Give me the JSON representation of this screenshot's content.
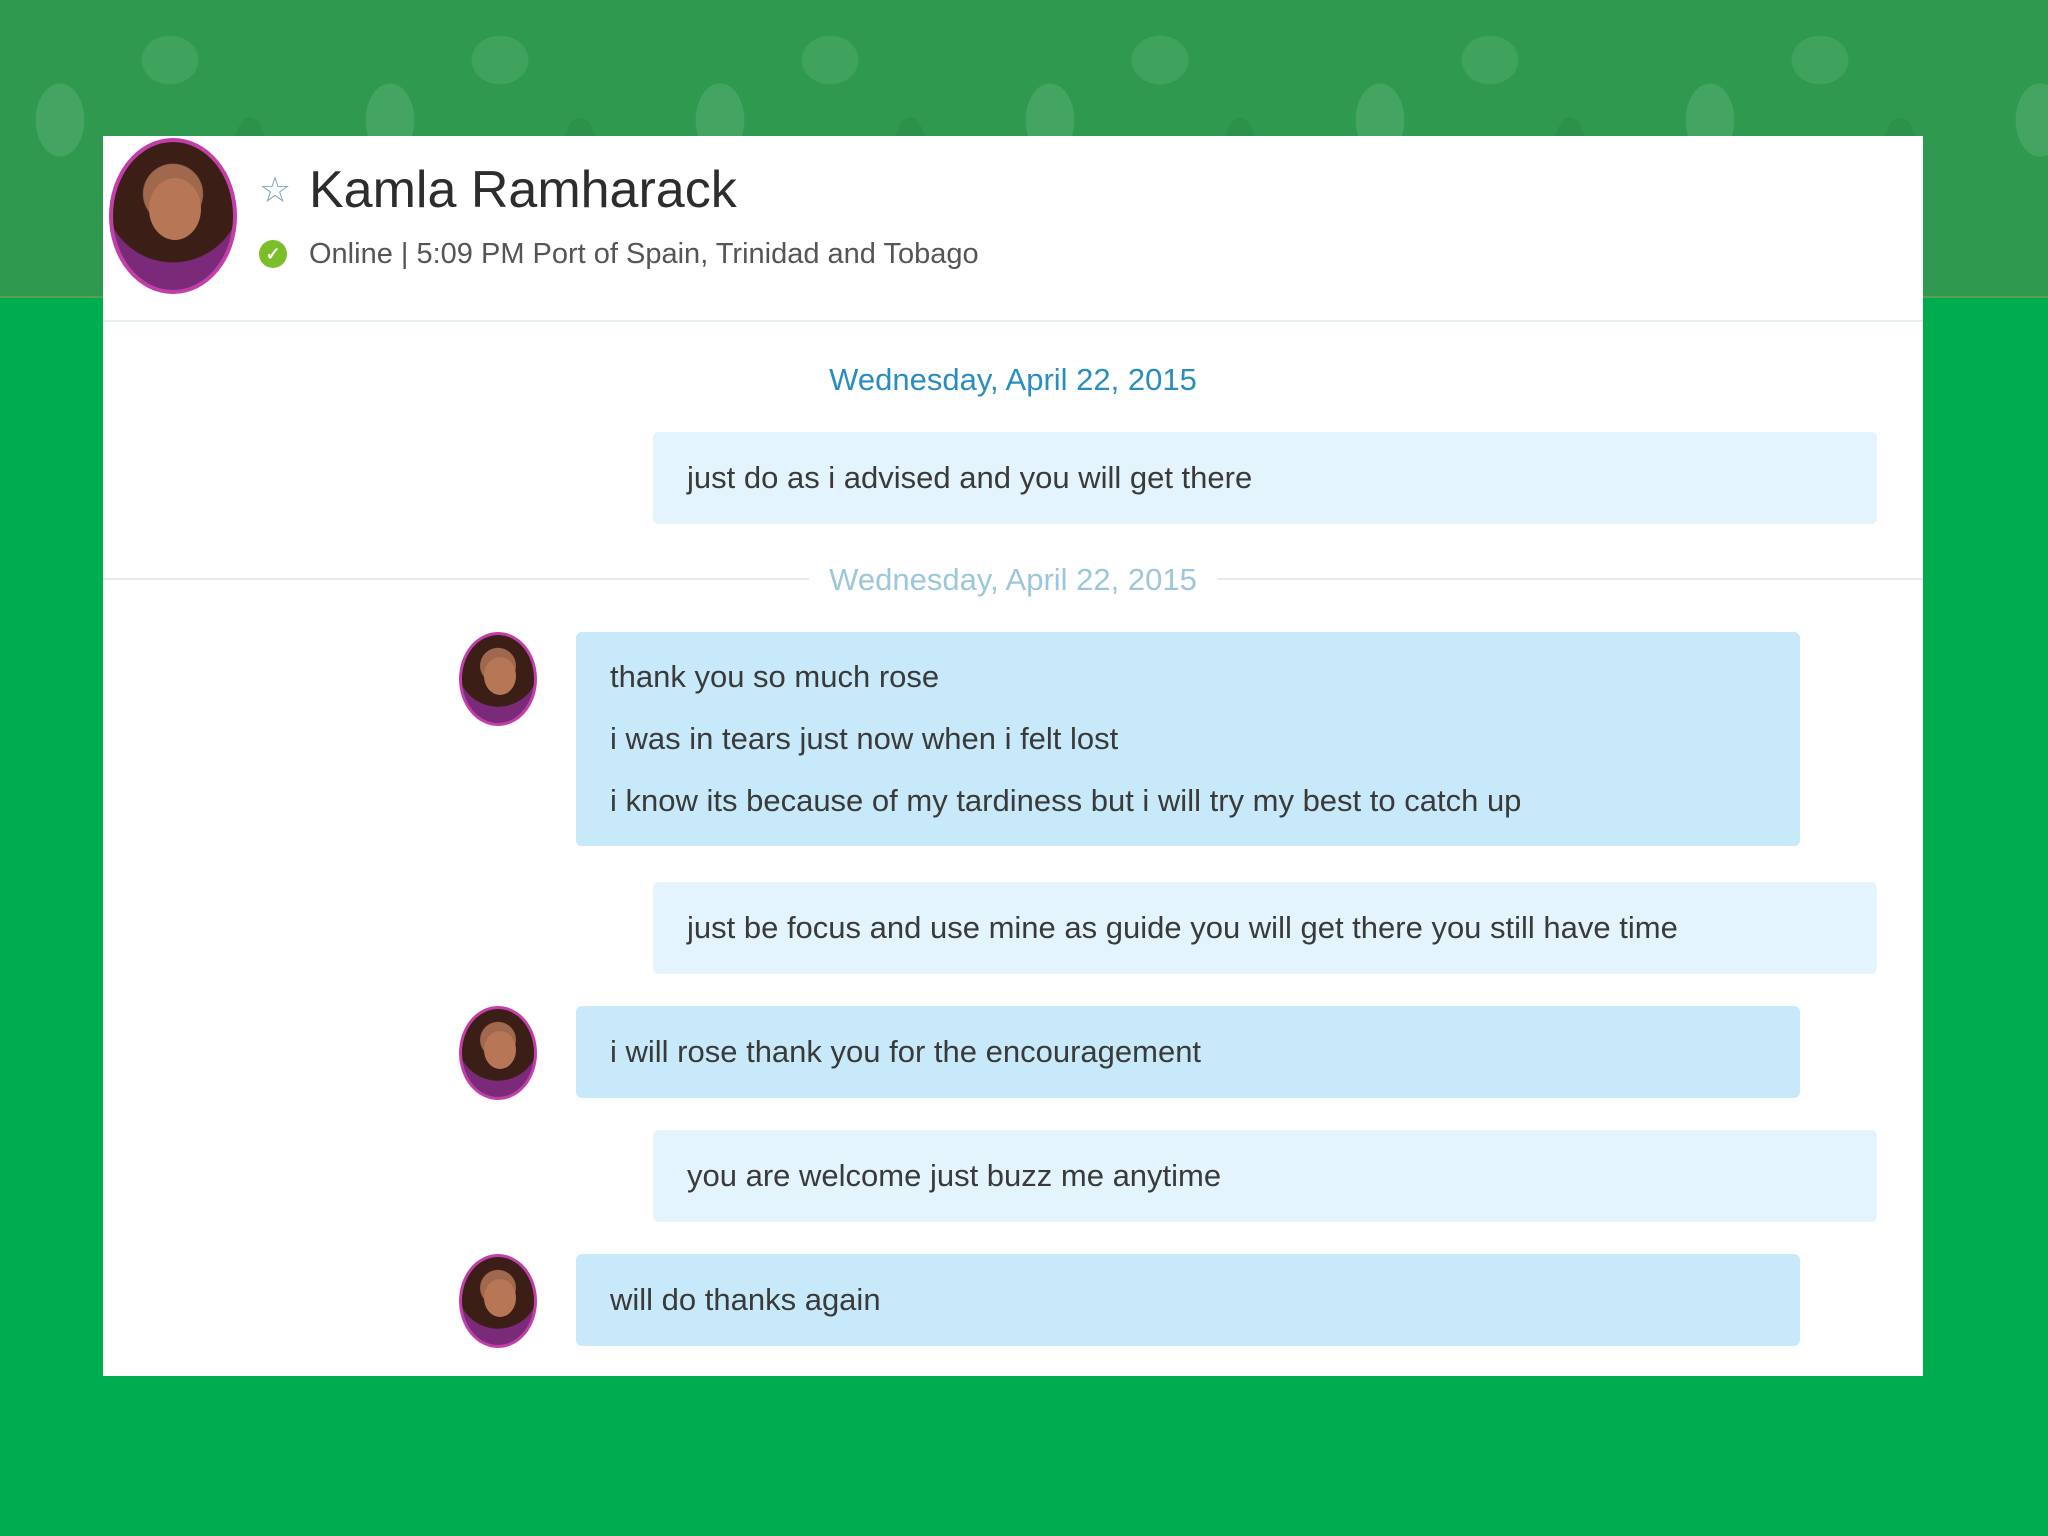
{
  "header": {
    "contact_name": "Kamla Ramharack",
    "star_icon": "star-outline-icon",
    "status_icon": "online-check-icon",
    "status_text": "Online  |  5:09 PM Port of Spain, Trinidad and Tobago"
  },
  "conversation": {
    "date_1": "Wednesday, April 22, 2015",
    "date_2": "Wednesday, April 22, 2015",
    "messages": [
      {
        "sender": "me",
        "lines": [
          "just do as i advised and you will get there"
        ]
      },
      {
        "sender": "contact",
        "lines": [
          "thank you so much rose",
          "i was in tears just now when i felt lost",
          "i know its because of my tardiness but i will try my best to catch up"
        ]
      },
      {
        "sender": "me",
        "lines": [
          "just be focus and use mine as guide you will get there you still have time"
        ]
      },
      {
        "sender": "contact",
        "lines": [
          "i will rose thank you for the encouragement"
        ]
      },
      {
        "sender": "me",
        "lines": [
          "you are welcome just buzz me anytime"
        ]
      },
      {
        "sender": "contact",
        "lines": [
          "will do thanks again"
        ]
      }
    ]
  },
  "colors": {
    "page_background": "#00ad4e",
    "banner": "#2f9a4f",
    "my_bubble": "#e3f4fc",
    "contact_bubble": "#c7e9fa",
    "date_accent": "#2a8dbf"
  }
}
